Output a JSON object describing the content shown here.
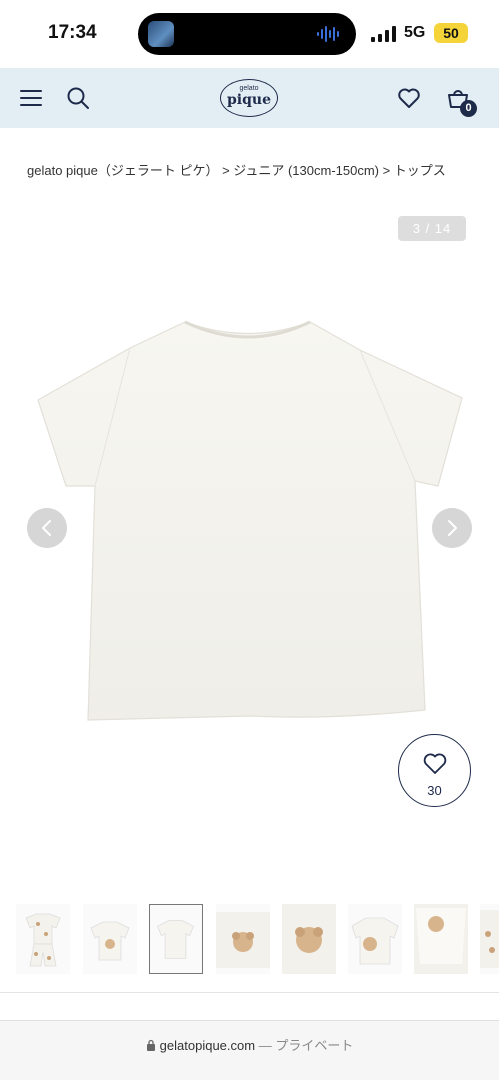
{
  "status_bar": {
    "time": "17:34",
    "network": "5G",
    "battery": "50"
  },
  "header": {
    "logo_small": "gelato",
    "logo_main": "pique",
    "cart_count": "0",
    "icons": [
      "menu-icon",
      "search-icon",
      "heart-icon",
      "cart-icon"
    ]
  },
  "breadcrumb": "gelato pique（ジェラート ピケ） > ジュニア (130cm-150cm) > トップス",
  "gallery": {
    "counter": "3 / 14",
    "favorite_count": "30",
    "thumbnail_count": 8,
    "selected_thumbnail": 3
  },
  "browser": {
    "url": "gelatopique.com",
    "private_label": "— プライベート"
  },
  "colors": {
    "header_bg": "#e3eef4",
    "brand_navy": "#1e2a4a",
    "battery_yellow": "#f5d43a"
  }
}
